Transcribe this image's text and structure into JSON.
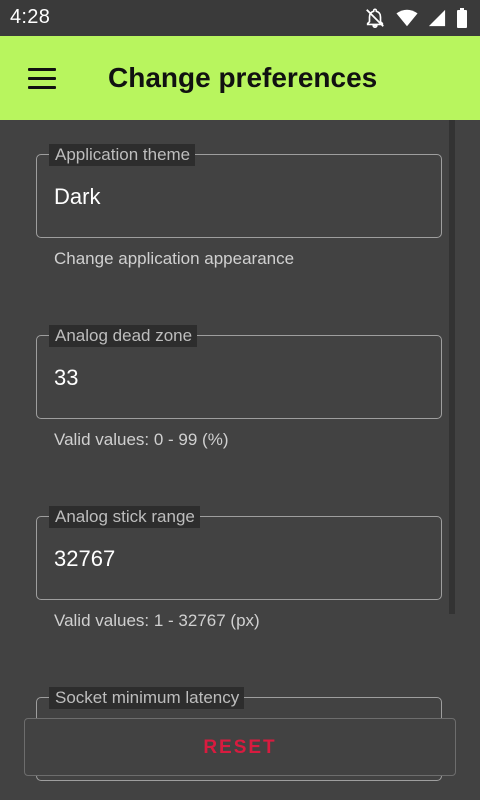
{
  "status_bar": {
    "time": "4:28",
    "icons": [
      "notifications-off-icon",
      "wifi-icon",
      "signal-icon",
      "battery-icon"
    ]
  },
  "app_bar": {
    "title": "Change preferences",
    "menu_icon": "menu-icon",
    "background_color": "#b8f55e"
  },
  "preferences": [
    {
      "label": "Application theme",
      "value": "Dark",
      "helper": "Change application appearance"
    },
    {
      "label": "Analog dead zone",
      "value": "33",
      "helper": "Valid values: 0 - 99 (%)"
    },
    {
      "label": "Analog stick range",
      "value": "32767",
      "helper": "Valid values: 1 - 32767 (px)"
    },
    {
      "label": "Socket minimum latency",
      "value": "",
      "helper": ""
    }
  ],
  "reset_button": {
    "label": "RESET",
    "color": "#d81b3f"
  }
}
